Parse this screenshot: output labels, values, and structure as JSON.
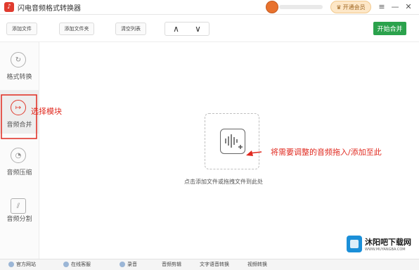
{
  "window": {
    "title": "闪电音频格式转换器",
    "member_label": "开通会员"
  },
  "toolbar": {
    "add_file": "添加文件",
    "add_folder": "添加文件夹",
    "clear_list": "清空列表",
    "up_label": "∧",
    "down_label": "∨",
    "start_merge": "开始合并"
  },
  "sidebar": {
    "items": [
      {
        "label": "格式转换"
      },
      {
        "label": "音频合并"
      },
      {
        "label": "音频压缩"
      },
      {
        "label": "音频分割"
      }
    ]
  },
  "main": {
    "drop_hint": "点击添加文件或拖拽文件到此处"
  },
  "annotations": {
    "select_module": "选择模块",
    "drag_hint": "将需要调整的音频拖入/添加至此"
  },
  "statusbar": {
    "items": [
      "官方网站",
      "在线客服",
      "录音",
      "音频剪辑",
      "文字语音转换",
      "视频转换"
    ]
  },
  "watermark": {
    "name": "沐阳吧下载网",
    "url": "WWW.MUYANGBA.COM"
  },
  "colors": {
    "accent": "#2ba24c",
    "annotation": "#e0291f",
    "brand": "#e03b2f"
  }
}
